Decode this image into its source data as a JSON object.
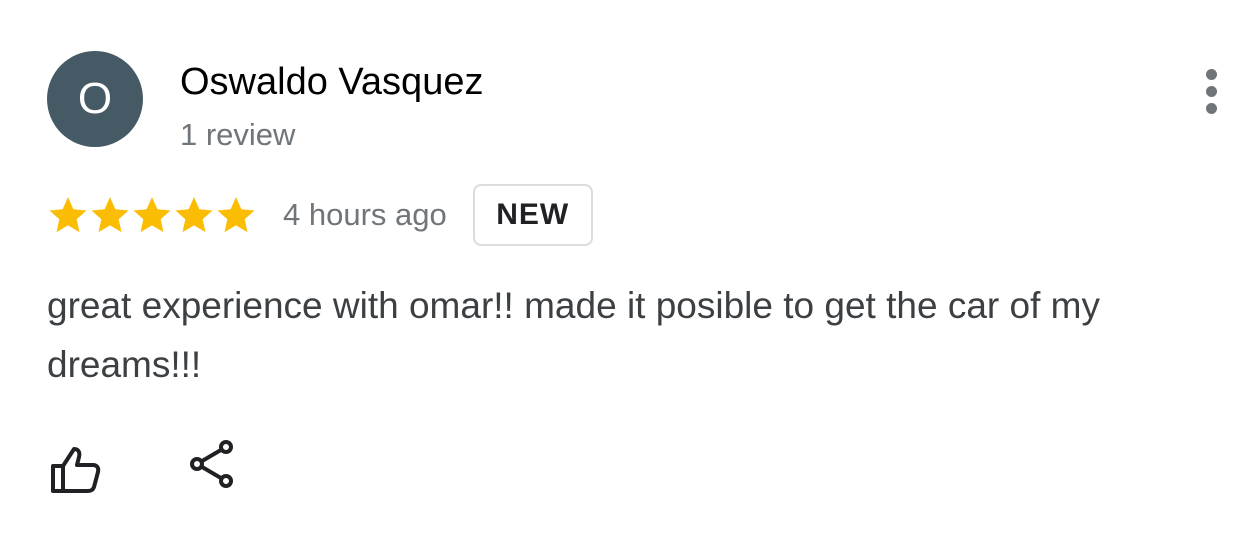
{
  "reviewer": {
    "initial": "O",
    "name": "Oswaldo Vasquez",
    "review_count": "1 review",
    "avatar_color": "#455a64"
  },
  "rating": {
    "stars": 5,
    "max_stars": 5,
    "star_color": "#fbbc04"
  },
  "timestamp": "4 hours ago",
  "badge": "NEW",
  "review_text": "great experience with omar!! made it posible to get the car of my dreams!!!",
  "icons": {
    "menu": "more-vert-icon",
    "like": "thumb-up-icon",
    "share": "share-icon"
  }
}
